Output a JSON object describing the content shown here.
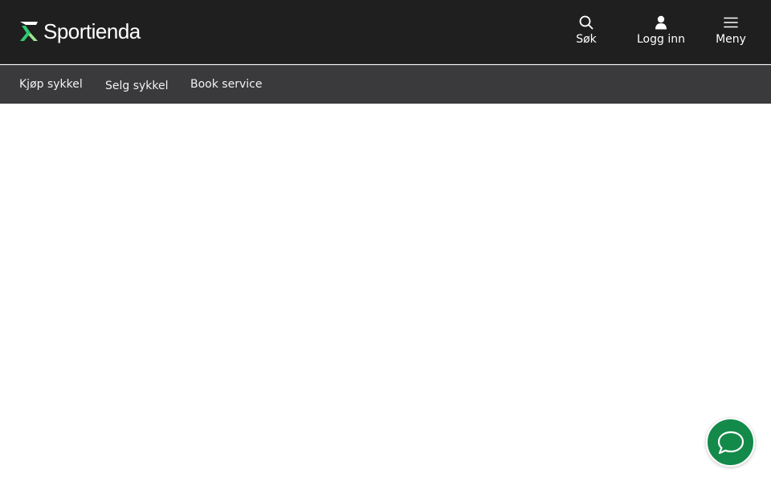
{
  "brand": {
    "name": "Sportienda",
    "logo_icon": "sportienda-logo-icon",
    "accent_color": "#2ecc71"
  },
  "header": {
    "actions": [
      {
        "icon": "search-icon",
        "label": "Søk"
      },
      {
        "icon": "user-icon",
        "label": "Logg inn"
      },
      {
        "icon": "hamburger-menu-icon",
        "label": "Meny"
      }
    ]
  },
  "subnav": {
    "items": [
      {
        "label": "Kjøp sykkel"
      },
      {
        "label": "Selg sykkel"
      },
      {
        "label": "Book service"
      }
    ]
  },
  "chat": {
    "icon": "chat-bubble-icon",
    "color": "#138a4a"
  },
  "colors": {
    "topbar": "#1f1f1f",
    "subnav": "#3a3a3c",
    "background": "#ffffff"
  }
}
